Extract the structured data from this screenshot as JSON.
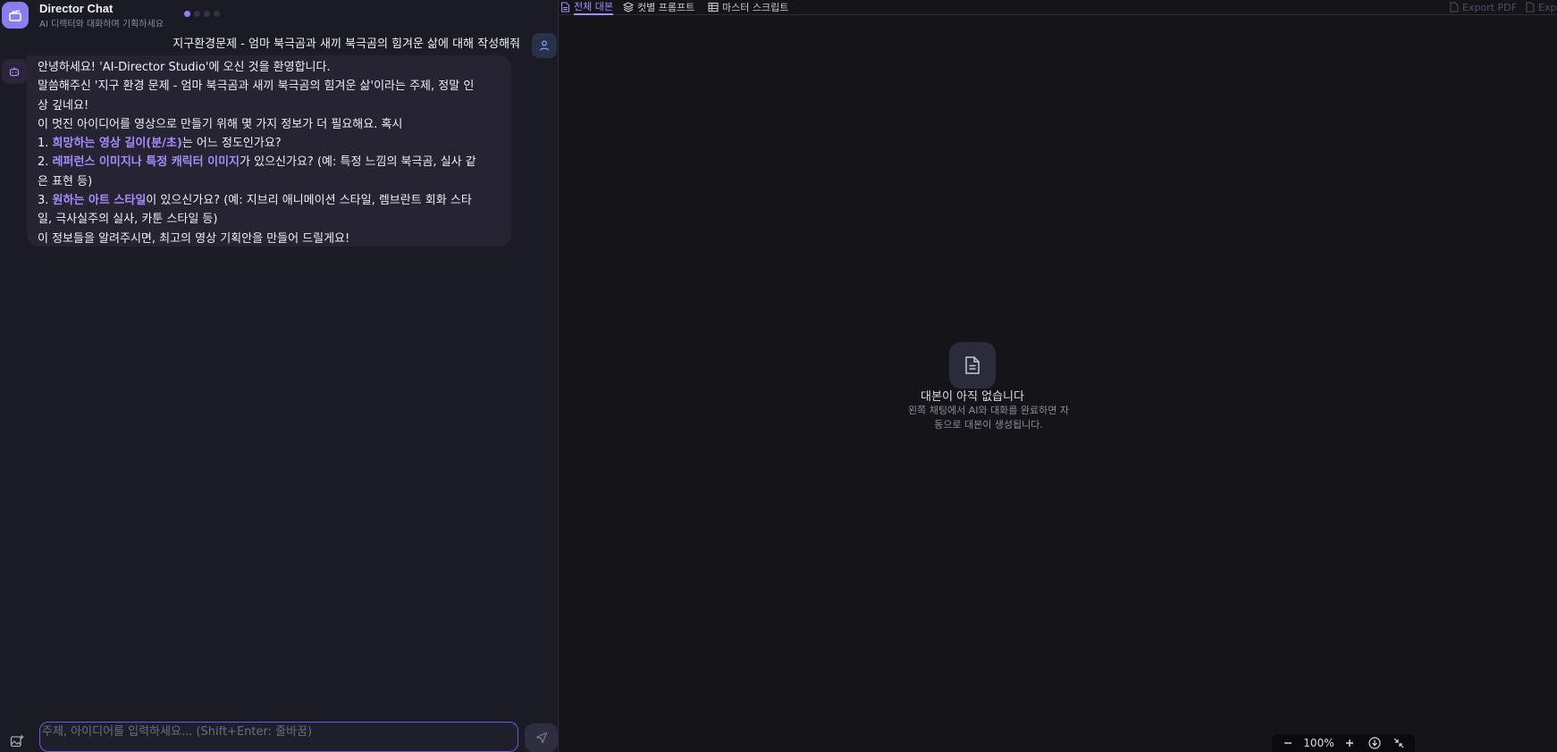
{
  "header": {
    "title": "Director Chat",
    "subtitle": "AI 디렉터와 대화하며 기획하세요"
  },
  "steps": {
    "total": 4,
    "active": 1
  },
  "chat": {
    "user_message": "지구환경문제 - 엄마 북극곰과 새끼 북극곰의 힘겨운 삶에 대해 작성해줘",
    "bot_lines": [
      [
        {
          "t": "안녕하세요! 'AI-Director Studio'에 오신 것을 환영합니다."
        }
      ],
      [
        {
          "t": "말씀해주신 '지구 환경 문제 - 엄마 북극곰과 새끼 북극곰의 힘겨운 삶'이라는 주제, 정말 인"
        }
      ],
      [
        {
          "t": "상 깊네요!"
        }
      ],
      [
        {
          "t": "이 멋진 아이디어를 영상으로 만들기 위해 몇 가지 정보가 더 필요해요. 혹시"
        }
      ],
      [
        {
          "t": "1.  "
        },
        {
          "t": "희망하는 영상 길이(분/초)",
          "h": true
        },
        {
          "t": "는 어느 정도인가요?"
        }
      ],
      [
        {
          "t": "2.  "
        },
        {
          "t": "레퍼런스 이미지나 특정 캐릭터 이미지",
          "h": true
        },
        {
          "t": "가 있으신가요? (예: 특정 느낌의 북극곰, 실사 같"
        }
      ],
      [
        {
          "t": "은 표현 등)"
        }
      ],
      [
        {
          "t": "3.  "
        },
        {
          "t": "원하는 아트 스타일",
          "h": true
        },
        {
          "t": "이 있으신가요? (예: 지브리 애니메이션 스타일, 렘브란트 회화 스타"
        }
      ],
      [
        {
          "t": "일, 극사실주의 실사, 카툰 스타일 등)"
        }
      ],
      [
        {
          "t": "이 정보들을 알려주시면, 최고의 영상 기획안을 만들어 드릴게요!"
        }
      ]
    ],
    "input_placeholder": "주제, 아이디어를 입력하세요... (Shift+Enter: 줄바꿈)"
  },
  "tabs": [
    {
      "label": "전체 대본",
      "icon": "document-icon",
      "active": true
    },
    {
      "label": "컷별 프롬프트",
      "icon": "layers-icon",
      "active": false
    },
    {
      "label": "마스터 스크립트",
      "icon": "table-icon",
      "active": false
    }
  ],
  "export": {
    "pdf_label": "Export PDF",
    "other_label": "Exp"
  },
  "empty_state": {
    "title": "대본이 아직 없습니다",
    "desc_line1": "왼쪽 채팅에서 AI와 대화를 완료하면 자",
    "desc_line2": "동으로 대본이 생성됩니다."
  },
  "zoom": {
    "level": "100%"
  },
  "colors": {
    "accent": "#a78bfa",
    "panel": "#1b1b26",
    "canvas": "#141419"
  }
}
